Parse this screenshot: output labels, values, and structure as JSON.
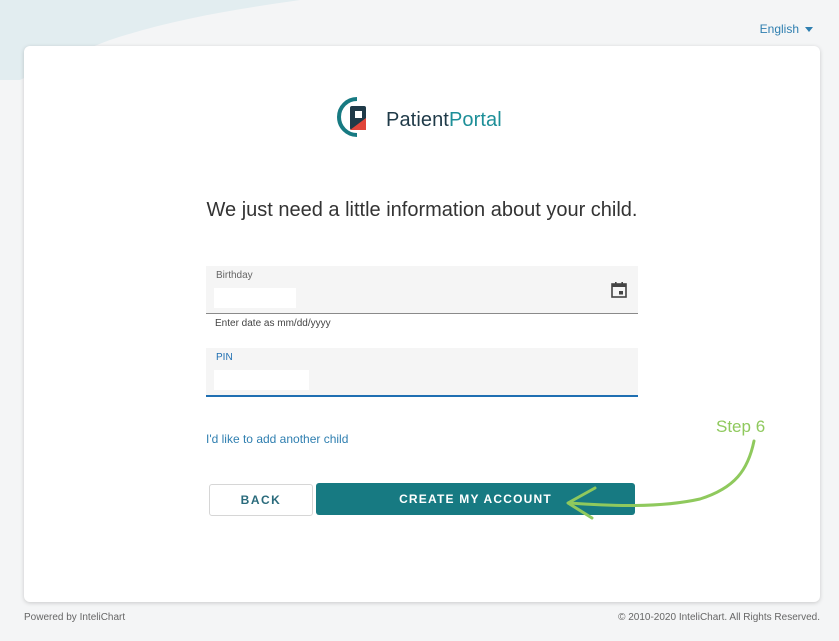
{
  "language": {
    "label": "English"
  },
  "logo": {
    "text_main": "Patient",
    "text_accent": "Portal"
  },
  "heading": "We just need a little information about your child.",
  "form": {
    "birthday": {
      "label": "Birthday",
      "value": "",
      "hint": "Enter date as mm/dd/yyyy"
    },
    "pin": {
      "label": "PIN",
      "value": ""
    }
  },
  "add_child_link": "I'd like to add another child",
  "buttons": {
    "back": "BACK",
    "create": "CREATE MY ACCOUNT"
  },
  "annotation": {
    "step_label": "Step 6",
    "color": "#8fc95d"
  },
  "footer": {
    "left": "Powered by InteliChart",
    "right": "© 2010-2020 InteliChart. All Rights Reserved."
  },
  "colors": {
    "primary": "#177a82",
    "link": "#2f7fb0",
    "logo_red": "#e0453a"
  }
}
